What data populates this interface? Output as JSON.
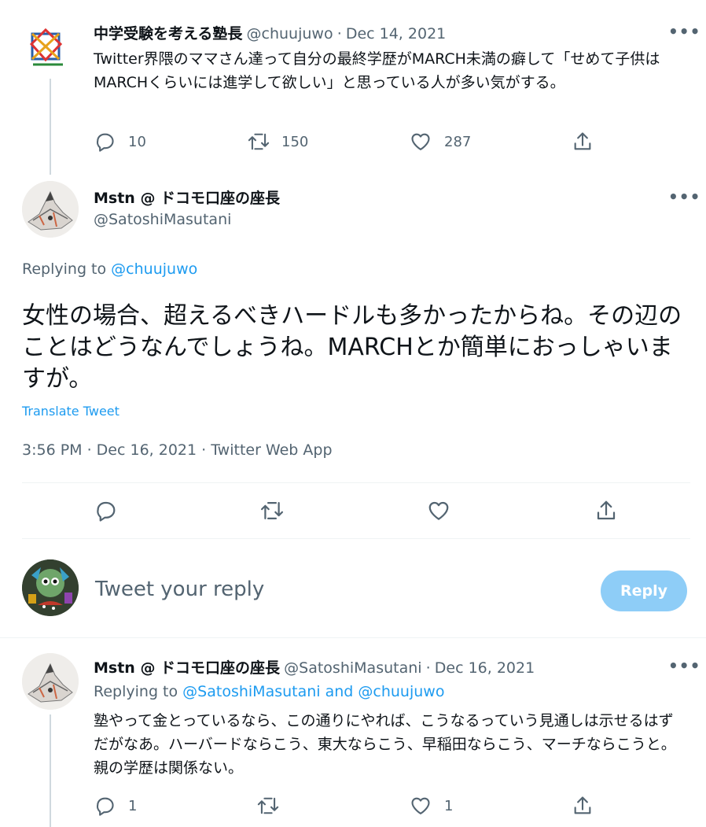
{
  "tweet1": {
    "name": "中学受験を考える塾長",
    "handle": "@chuujuwo",
    "sep": "·",
    "date": "Dec 14, 2021",
    "text": "Twitter界隈のママさん達って自分の最終学歴がMARCH未満の癖して「せめて子供はMARCHくらいには進学して欲しい」と思っている人が多い気がする。",
    "reply_count": "10",
    "retweet_count": "150",
    "like_count": "287"
  },
  "main": {
    "name": "Mstn @ ドコモ口座の座長",
    "handle": "@SatoshiMasutani",
    "replying_label": "Replying to",
    "replying_handle": "@chuujuwo",
    "text": "女性の場合、超えるべきハードルも多かったからね。その辺のことはどうなんでしょうね。MARCHとか簡単におっしゃいますが。",
    "translate": "Translate Tweet",
    "timestamp": "3:56 PM · Dec 16, 2021 · Twitter Web App"
  },
  "composer": {
    "placeholder": "Tweet your reply",
    "reply_button": "Reply"
  },
  "tweet3": {
    "name": "Mstn @ ドコモ口座の座長",
    "handle": "@SatoshiMasutani",
    "sep": "·",
    "date": "Dec 16, 2021",
    "replying_label": "Replying to",
    "replying_handles": "@SatoshiMasutani and @chuujuwo",
    "text": "塾やって金とっているなら、この通りにやれば、こうなるっていう見通しは示せるはずだがなあ。ハーバードならこう、東大ならこう、早稲田ならこう、マーチならこうと。親の学歴は関係ない。",
    "reply_count": "1",
    "like_count": "1"
  },
  "more_label": "•••",
  "colors": {
    "accent": "#1d9bf0",
    "reply_button_disabled": "#8ecdf7",
    "muted": "#536471",
    "divider": "#eff3f4"
  }
}
